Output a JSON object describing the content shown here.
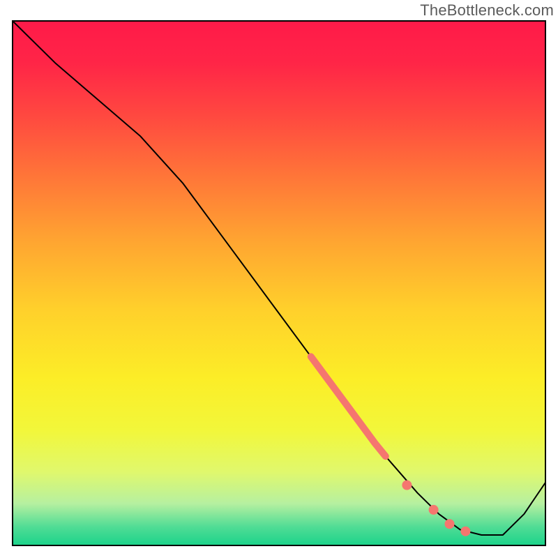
{
  "watermark": "TheBottleneck.com",
  "chart_data": {
    "type": "line",
    "title": "",
    "xlabel": "",
    "ylabel": "",
    "xlim": [
      0,
      100
    ],
    "ylim": [
      0,
      100
    ],
    "grid": false,
    "background_gradient": {
      "stops": [
        {
          "offset": 0.0,
          "color": "#ff1a49"
        },
        {
          "offset": 0.08,
          "color": "#ff2547"
        },
        {
          "offset": 0.18,
          "color": "#ff4840"
        },
        {
          "offset": 0.3,
          "color": "#ff7738"
        },
        {
          "offset": 0.42,
          "color": "#ffa531"
        },
        {
          "offset": 0.55,
          "color": "#ffd02b"
        },
        {
          "offset": 0.68,
          "color": "#fced27"
        },
        {
          "offset": 0.78,
          "color": "#f2f73a"
        },
        {
          "offset": 0.86,
          "color": "#e0f86d"
        },
        {
          "offset": 0.92,
          "color": "#b6f0a0"
        },
        {
          "offset": 0.965,
          "color": "#4fdc95"
        },
        {
          "offset": 1.0,
          "color": "#1bd38a"
        }
      ]
    },
    "series": [
      {
        "name": "bottleneck-curve",
        "type": "line",
        "color": "#000000",
        "width": 2,
        "x": [
          0,
          8,
          16,
          24,
          32,
          40,
          48,
          56,
          64,
          70,
          76,
          80,
          84,
          88,
          92,
          96,
          100
        ],
        "y": [
          100,
          92,
          85,
          78,
          69,
          58,
          47,
          36,
          25,
          17,
          10,
          6,
          3,
          2,
          2,
          6,
          12
        ]
      },
      {
        "name": "highlight-segment",
        "type": "line",
        "color": "#f5766f",
        "width": 10,
        "x": [
          56,
          60,
          64,
          68,
          70
        ],
        "y": [
          36,
          30.5,
          25,
          19.5,
          17
        ]
      },
      {
        "name": "highlight-points",
        "type": "scatter",
        "color": "#f5766f",
        "radius": 7,
        "x": [
          74,
          79,
          82,
          85
        ],
        "y": [
          11.5,
          6.8,
          4.1,
          2.7
        ]
      }
    ]
  }
}
